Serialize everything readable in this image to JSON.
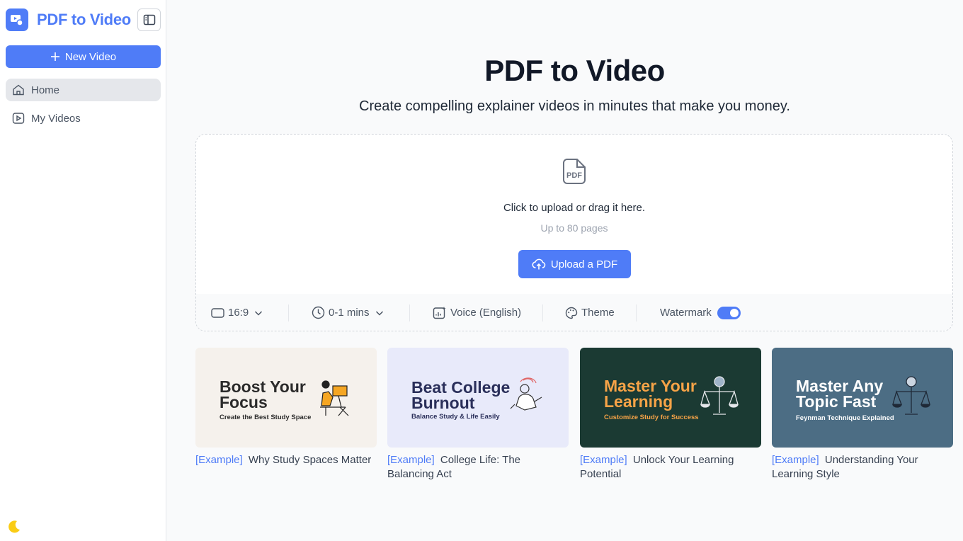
{
  "sidebar": {
    "brand": "PDF to Video",
    "new_video_label": "New Video",
    "nav": [
      {
        "label": "Home",
        "icon": "home-icon",
        "active": true
      },
      {
        "label": "My Videos",
        "icon": "play-square-icon",
        "active": false
      }
    ]
  },
  "main": {
    "title": "PDF to Video",
    "subtitle": "Create compelling explainer videos in minutes that make you money.",
    "upload": {
      "prompt": "Click to upload or drag it here.",
      "limit": "Up to 80 pages",
      "button_label": "Upload a PDF"
    },
    "options": {
      "aspect_ratio": "16:9",
      "duration": "0-1 mins",
      "voice": "Voice (English)",
      "theme": "Theme",
      "watermark": "Watermark",
      "watermark_enabled": true
    },
    "examples": [
      {
        "tag": "[Example]",
        "title": "Why Study Spaces Matter",
        "thumb_title": "Boost Your\nFocus",
        "thumb_subtitle": "Create the Best Study Space"
      },
      {
        "tag": "[Example]",
        "title": "College Life: The Balancing Act",
        "thumb_title": "Beat College\nBurnout",
        "thumb_subtitle": "Balance Study & Life Easily"
      },
      {
        "tag": "[Example]",
        "title": "Unlock Your Learning Potential",
        "thumb_title": "Master Your\nLearning",
        "thumb_subtitle": "Customize Study for Success"
      },
      {
        "tag": "[Example]",
        "title": "Understanding Your Learning Style",
        "thumb_title": "Master Any\nTopic Fast",
        "thumb_subtitle": "Feynman Technique Explained"
      }
    ]
  },
  "colors": {
    "accent": "#4f7cf7",
    "sidebar_bg": "#ffffff",
    "page_bg": "#f9fafb",
    "thumb_bg": [
      "#f5f1ec",
      "#e8eafa",
      "#1b3a33",
      "#4c6d84"
    ]
  }
}
